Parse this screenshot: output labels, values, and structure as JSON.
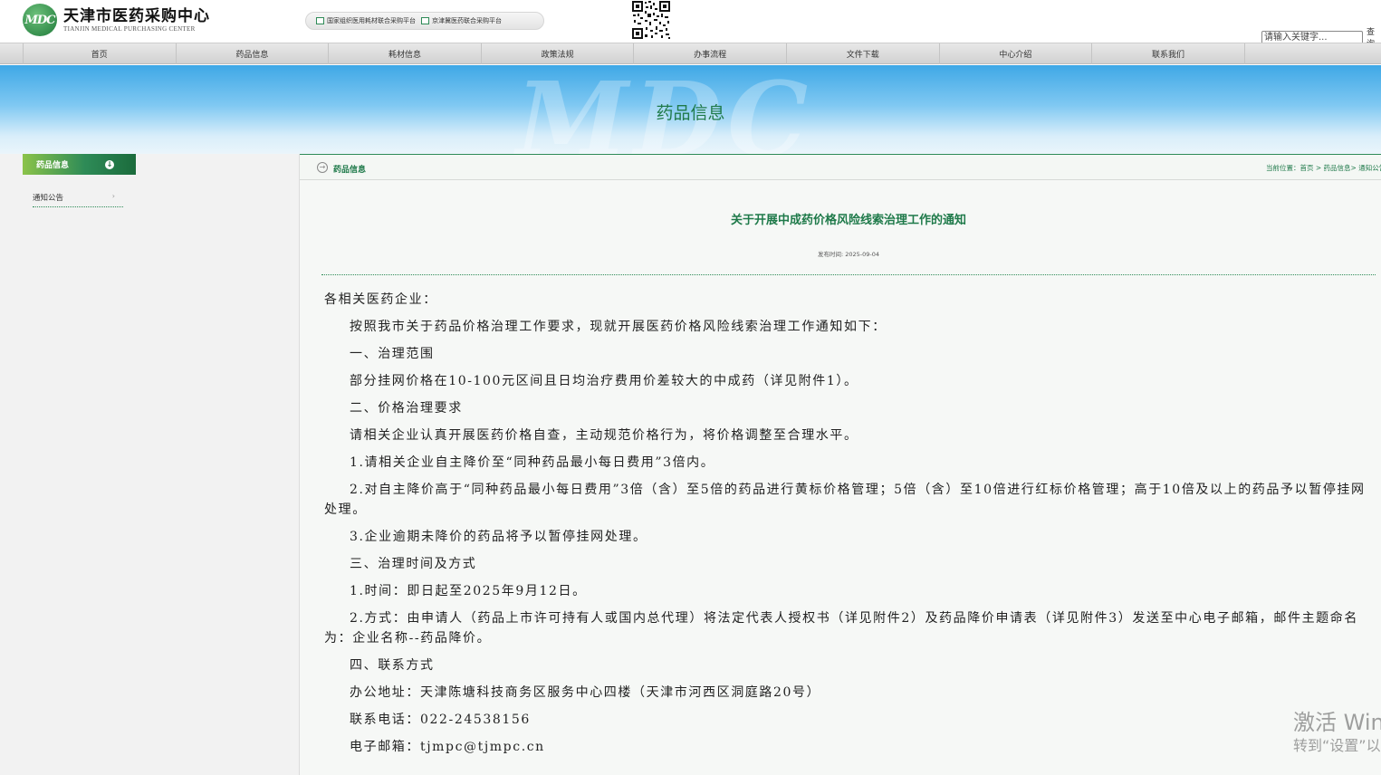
{
  "header": {
    "logo_mark": "MDC",
    "logo_cn": "天津市医药采购中心",
    "logo_en": "TIANJIN MEDICAL PURCHASING CENTER",
    "platforms": [
      "国家组织医用耗材联合采购平台",
      "京津冀医药联合采购平台"
    ],
    "qr_icon": "qr-code-icon",
    "search_placeholder": "请输入关键字...",
    "search_button": "查询"
  },
  "nav": {
    "items": [
      "首页",
      "药品信息",
      "耗材信息",
      "政策法规",
      "办事流程",
      "文件下载",
      "中心介绍",
      "联系我们"
    ]
  },
  "banner": {
    "watermark": "MDC",
    "title": "药品信息"
  },
  "sidebar": {
    "head": "药品信息",
    "items": [
      {
        "label": "通知公告"
      }
    ]
  },
  "breadcrumb": {
    "title": "药品信息",
    "path": "当前位置：首页 > 药品信息> 通知公告"
  },
  "article": {
    "title": "关于开展中成药价格风险线索治理工作的通知",
    "date": "发布时间: 2025-09-04",
    "paragraphs": [
      "各相关医药企业：",
      "按照我市关于药品价格治理工作要求，现就开展医药价格风险线索治理工作通知如下：",
      "一、治理范围",
      "部分挂网价格在10-100元区间且日均治疗费用价差较大的中成药（详见附件1）。",
      "二、价格治理要求",
      "请相关企业认真开展医药价格自查，主动规范价格行为，将价格调整至合理水平。",
      "1.请相关企业自主降价至“同种药品最小每日费用”3倍内。",
      "2.对自主降价高于“同种药品最小每日费用”3倍（含）至5倍的药品进行黄标价格管理；5倍（含）至10倍进行红标价格管理；高于10倍及以上的药品予以暂停挂网处理。",
      "3.企业逾期未降价的药品将予以暂停挂网处理。",
      "三、治理时间及方式",
      "1.时间：即日起至2025年9月12日。",
      "2.方式：由申请人（药品上市许可持有人或国内总代理）将法定代表人授权书（详见附件2）及药品降价申请表（详见附件3）发送至中心电子邮箱，邮件主题命名为：企业名称--药品降价。",
      "四、联系方式",
      "办公地址：天津陈塘科技商务区服务中心四楼（天津市河西区洞庭路20号）",
      "联系电话：022-24538156",
      "电子邮箱：tjmpc@tjmpc.cn"
    ]
  },
  "watermark": {
    "line1": "激活 Windows",
    "line2": "转到“设置”以激活 Windows。"
  }
}
